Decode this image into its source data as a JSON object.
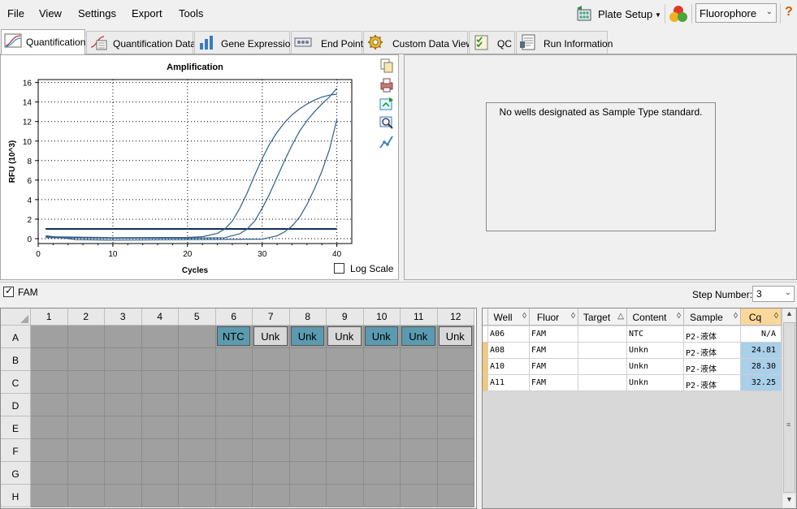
{
  "menu": [
    "File",
    "View",
    "Settings",
    "Export",
    "Tools"
  ],
  "toolbar": {
    "plate_setup": "Plate Setup",
    "fluorophore": "Fluorophore",
    "help": "?"
  },
  "tabs": [
    {
      "label": "Quantification",
      "icon": "amplification-chart-icon",
      "active": true
    },
    {
      "label": "Quantification Data",
      "icon": "quantification-data-icon"
    },
    {
      "label": "Gene Expression",
      "icon": "bar-chart-icon"
    },
    {
      "label": "End Point",
      "icon": "end-point-icon"
    },
    {
      "label": "Custom Data View",
      "icon": "gear-icon"
    },
    {
      "label": "QC",
      "icon": "qc-checklist-icon"
    },
    {
      "label": "Run Information",
      "icon": "run-information-icon"
    }
  ],
  "chart_data": {
    "type": "line",
    "title": "Amplification",
    "xlabel": "Cycles",
    "ylabel": "RFU (10^3)",
    "xlim": [
      0,
      42
    ],
    "ylim": [
      -0.5,
      16.3
    ],
    "xticks": [
      0,
      10,
      20,
      30,
      40
    ],
    "yticks": [
      0,
      2,
      4,
      6,
      8,
      10,
      12,
      14,
      16
    ],
    "grid": true,
    "threshold": 1.0,
    "series": [
      {
        "values": [
          [
            1,
            0.2
          ],
          [
            10,
            0.1
          ],
          [
            20,
            0.12
          ],
          [
            22,
            0.2
          ],
          [
            24,
            0.55
          ],
          [
            25,
            1.0
          ],
          [
            26,
            1.8
          ],
          [
            27,
            3.1
          ],
          [
            28,
            4.7
          ],
          [
            29,
            6.5
          ],
          [
            30,
            8.2
          ],
          [
            31,
            9.7
          ],
          [
            32,
            10.9
          ],
          [
            33,
            11.9
          ],
          [
            34,
            12.7
          ],
          [
            35,
            13.3
          ],
          [
            36,
            13.8
          ],
          [
            37,
            14.2
          ],
          [
            38,
            14.5
          ],
          [
            39,
            14.7
          ],
          [
            40,
            14.8
          ]
        ]
      },
      {
        "values": [
          [
            1,
            0.1
          ],
          [
            10,
            0.05
          ],
          [
            20,
            0.05
          ],
          [
            25,
            0.1
          ],
          [
            27,
            0.5
          ],
          [
            28,
            1.0
          ],
          [
            29,
            1.8
          ],
          [
            30,
            3.1
          ],
          [
            31,
            4.6
          ],
          [
            32,
            6.3
          ],
          [
            33,
            8.0
          ],
          [
            34,
            9.6
          ],
          [
            35,
            11.0
          ],
          [
            36,
            12.1
          ],
          [
            37,
            13.0
          ],
          [
            38,
            13.8
          ],
          [
            39,
            14.5
          ],
          [
            40,
            15.4
          ]
        ]
      },
      {
        "values": [
          [
            1,
            0.3
          ],
          [
            5,
            -0.1
          ],
          [
            10,
            -0.15
          ],
          [
            20,
            -0.1
          ],
          [
            30,
            -0.05
          ],
          [
            32,
            0.3
          ],
          [
            33,
            0.7
          ],
          [
            34,
            1.3
          ],
          [
            35,
            2.2
          ],
          [
            36,
            3.5
          ],
          [
            37,
            5.1
          ],
          [
            38,
            6.9
          ],
          [
            39,
            9.1
          ],
          [
            40,
            12.2
          ]
        ]
      }
    ]
  },
  "log_scale_label": "Log Scale",
  "std_message": "No wells designated as Sample Type standard.",
  "fam_label": "FAM",
  "step_number": {
    "label": "Step Number:",
    "value": "3"
  },
  "plate": {
    "columns": [
      "1",
      "2",
      "3",
      "4",
      "5",
      "6",
      "7",
      "8",
      "9",
      "10",
      "11",
      "12"
    ],
    "rows": [
      "A",
      "B",
      "C",
      "D",
      "E",
      "F",
      "G",
      "H"
    ],
    "wells_A": [
      "",
      "",
      "",
      "",
      "",
      "NTC",
      "Unk",
      "Unk",
      "Unk",
      "Unk",
      "Unk",
      "Unk"
    ],
    "well_style_A": [
      "",
      "",
      "",
      "",
      "",
      "ntc",
      "unk-grey",
      "unk-blue",
      "unk-grey",
      "unk-blue",
      "unk-blue",
      "unk-grey"
    ]
  },
  "table": {
    "columns": [
      "Well",
      "Fluor",
      "Target",
      "Content",
      "Sample",
      "Cq"
    ],
    "rows": [
      [
        "A06",
        "FAM",
        "",
        "NTC",
        "P2-液体",
        "N/A"
      ],
      [
        "A08",
        "FAM",
        "",
        "Unkn",
        "P2-液体",
        "24.81"
      ],
      [
        "A10",
        "FAM",
        "",
        "Unkn",
        "P2-液体",
        "28.30"
      ],
      [
        "A11",
        "FAM",
        "",
        "Unkn",
        "P2-液体",
        "32.25"
      ]
    ],
    "marked_rows": [
      1,
      2,
      3
    ],
    "selected_cq_rows": [
      1,
      2,
      3
    ]
  },
  "colors": {
    "curve": "#2e5e8e",
    "threshold": "#0f2f5a",
    "well_blue": "#5b9bb0",
    "cq_selected": "#a9cfe9",
    "sort_header": "#fbd79a"
  }
}
